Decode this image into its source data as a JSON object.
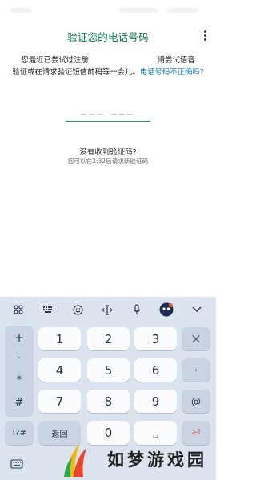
{
  "header": {
    "title": "验证您的电话号码",
    "menu_icon": "more-vert-icon"
  },
  "description": {
    "line1_prefix": "您最近已尝试过注册",
    "line1_suffix": "请尝试语音",
    "line2": "验证或在请求验证短信前稍等一会儿。",
    "link": "电话号码不正确吗?"
  },
  "code_input": {
    "placeholder": "___  ___"
  },
  "resend": {
    "title": "没有收到验证码?",
    "countdown": "您可以在2:32后请求新验证码"
  },
  "keyboard": {
    "toolbar": [
      "grid-icon",
      "keyboard-icon",
      "emoji-icon",
      "cursor-icon",
      "mic-icon",
      "game-icon",
      "chevron-down-icon"
    ],
    "symbols": [
      "+",
      "·",
      "*",
      "#"
    ],
    "rows": [
      [
        "1",
        "2",
        "3"
      ],
      [
        "4",
        "5",
        "6"
      ],
      [
        "7",
        "8",
        "9"
      ],
      [
        "返回",
        "0",
        "␣"
      ]
    ],
    "right_keys": [
      "×",
      "·",
      "@",
      "⏎"
    ],
    "switch_label": "!?#",
    "back_label": "返回"
  },
  "watermark": {
    "text": "如梦游戏园"
  }
}
